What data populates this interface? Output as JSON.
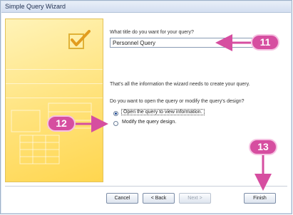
{
  "window": {
    "title": "Simple Query Wizard"
  },
  "wizard": {
    "title_prompt": "What title do you want for your query?",
    "title_value": "Personnel Query",
    "info_text": "That's all the information the wizard needs to create your query.",
    "question": "Do you want to open the query or modify the query's design?",
    "options": [
      {
        "label": "Open the query to view information.",
        "selected": true
      },
      {
        "label": "Modify the query design.",
        "selected": false
      }
    ]
  },
  "buttons": {
    "cancel": "Cancel",
    "back": "< Back",
    "next": "Next >",
    "finish": "Finish"
  },
  "callouts": {
    "c11": "11",
    "c12": "12",
    "c13": "13"
  },
  "colors": {
    "callout": "#d64ea0",
    "hero": "#ffd64f"
  },
  "icons": {
    "hero": "checkmark-icon"
  }
}
